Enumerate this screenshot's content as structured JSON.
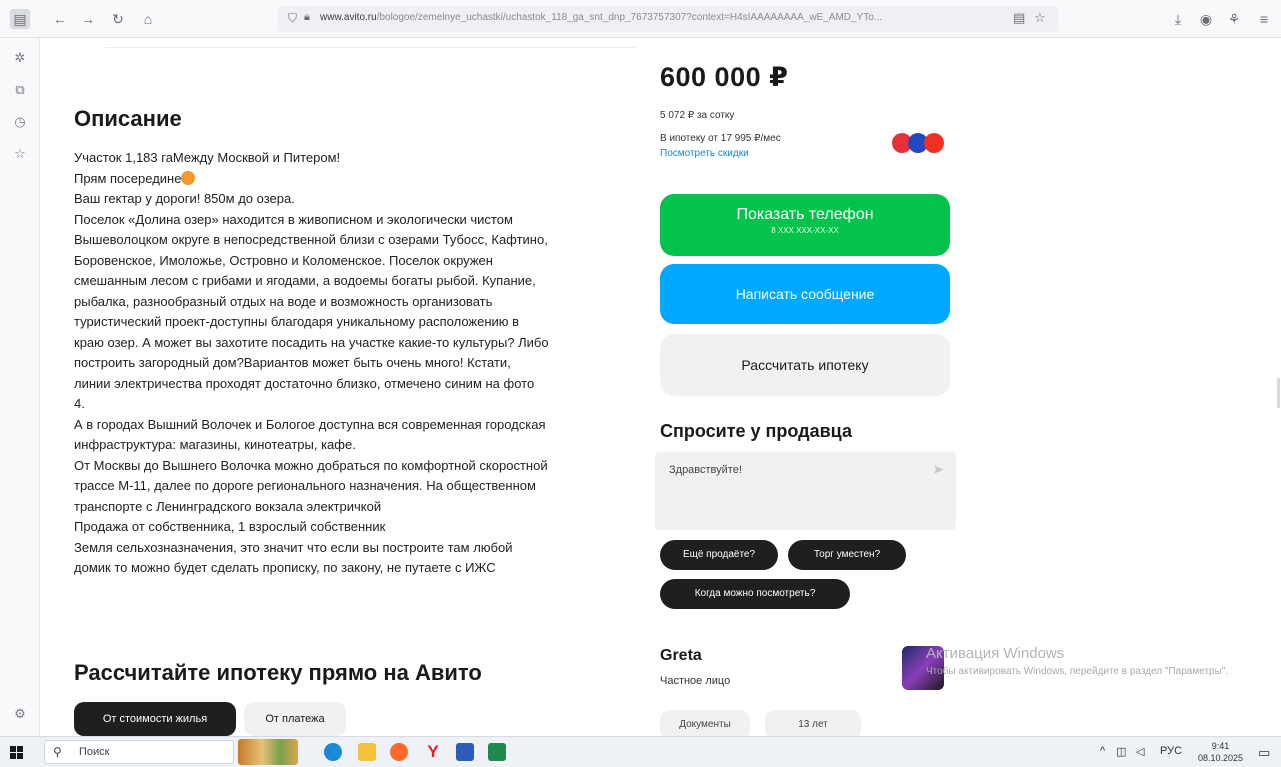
{
  "browser": {
    "url_host": "www.avito.ru",
    "url_path": "/bologoe/zemelnye_uchastki/uchastok_118_ga_snt_dnp_7673757307?context=H4sIAAAAAAAA_wE_AMD_YTo..."
  },
  "description": {
    "title": "Описание",
    "lines": [
      "Участок 1,183 гаМежду Москвой и Питером!",
      "Прям посередине",
      "Ваш гектар у дороги! 850м до озера.",
      "Поселок «Долина озер» находится в живописном и экологически чистом",
      "Вышеволоцком округе в непосредственной близи с озерами Тубосс, Кафтино,",
      "Боровенское, Имоложье, Островно и Коломенское. Поселок окружен",
      "смешанным лесом с грибами и ягодами, а водоемы богаты рыбой. Купание,",
      "рыбалка, разнообразный отдых на воде и возможность организовать",
      "туристический проект-доступны благодаря уникальному расположению в",
      "краю озер. А может вы захотите посадить на участке какие-то культуры? Либо",
      "построить загородный дом?Вариантов может быть очень много! Кстати,",
      "линии электричества проходят достаточно близко, отмечено синим на фото",
      "4.",
      "А в городах Вышний Волочек и Бологое доступна вся современная городская",
      "инфраструктура: магазины, кинотеатры, кафе.",
      "От Москвы до Вышнего Волочка можно добраться по комфортной скоростной",
      "трассе М-11, далее по дороге регионального назначения. На общественном",
      "транспорте с Ленинградского вокзала электричкой",
      "Продажа от собственника, 1 взрослый собственник",
      "Земля сельхозназначения, это значит что если вы построите там любой",
      "домик то можно будет сделать прописку, по закону, не путаете с ИЖС"
    ]
  },
  "mortgage_section": {
    "title": "Рассчитайте ипотеку прямо на Авито",
    "tab_active": "От стоимости жилья",
    "tab_other": "От платежа"
  },
  "listing": {
    "price": "600 000 ₽",
    "per_acre": "5 072 ₽ за сотку",
    "mortgage_from": "В ипотеку от 17 995 ₽/мес",
    "discounts_link": "Посмотреть скидки",
    "phone_button": "Показать телефон",
    "phone_masked": "8 XXX XXX-XX-XX",
    "message_button": "Написать сообщение",
    "calc_button": "Рассчитать ипотеку"
  },
  "ask_seller": {
    "title": "Спросите у продавца",
    "message": "Здравствуйте!",
    "chips": [
      "Ещё продаёте?",
      "Торг уместен?",
      "Когда можно посмотреть?"
    ]
  },
  "seller": {
    "name": "Greta",
    "type": "Частное лицо",
    "badge_documents": "Документы",
    "badge_years": "13 лет"
  },
  "windows_activation": {
    "title": "Активация Windows",
    "text": "Чтобы активировать Windows, перейдите в раздел \"Параметры\"."
  },
  "taskbar": {
    "search_placeholder": "Поиск",
    "lang": "РУС",
    "time": "9:41",
    "date": "08.10.2025"
  },
  "colors": {
    "green": "#04c34c",
    "blue": "#00a9ff",
    "gray_button": "#f2f1f0",
    "link": "#0a88e6"
  }
}
